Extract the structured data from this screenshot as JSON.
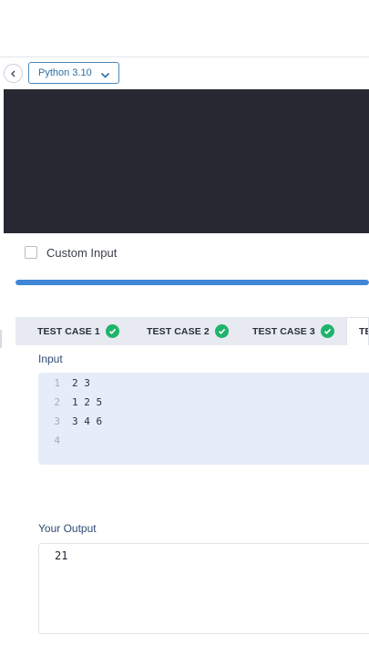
{
  "toolbar": {
    "language": "Python 3.10"
  },
  "custom_input": {
    "label": "Custom Input",
    "checked": false
  },
  "progress": {
    "percent": 100
  },
  "tabs": [
    {
      "label": "TEST CASE 1",
      "passed": true
    },
    {
      "label": "TEST CASE 2",
      "passed": true
    },
    {
      "label": "TEST CASE 3",
      "passed": true
    },
    {
      "label": "TE",
      "passed": false
    }
  ],
  "input_section": {
    "label": "Input",
    "lines": [
      {
        "num": "1",
        "text": "2 3"
      },
      {
        "num": "2",
        "text": "1 2 5"
      },
      {
        "num": "3",
        "text": "3 4 6"
      },
      {
        "num": "4",
        "text": ""
      }
    ]
  },
  "output_section": {
    "label": "Your Output",
    "value": "21"
  },
  "colors": {
    "accent": "#3f86d6",
    "success": "#1fb36b",
    "editor_bg": "#262932",
    "input_bg": "#e6edf8"
  }
}
